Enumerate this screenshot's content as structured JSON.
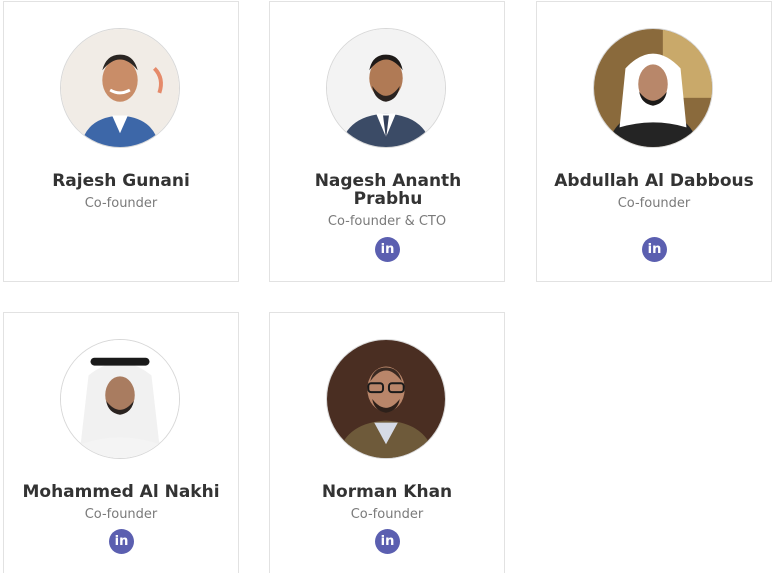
{
  "team": [
    {
      "name": "Rajesh Gunani",
      "role": "Co-founder",
      "has_linkedin": false,
      "photo_icon": "person-photo"
    },
    {
      "name": "Nagesh Ananth Prabhu",
      "role": "Co-founder & CTO",
      "has_linkedin": true,
      "photo_icon": "person-photo"
    },
    {
      "name": "Abdullah Al Dabbous",
      "role": "Co-founder",
      "has_linkedin": true,
      "photo_icon": "person-photo"
    },
    {
      "name": "Mohammed Al Nakhi",
      "role": "Co-founder",
      "has_linkedin": true,
      "photo_icon": "person-photo"
    },
    {
      "name": "Norman Khan",
      "role": "Co-founder",
      "has_linkedin": true,
      "photo_icon": "person-photo"
    }
  ],
  "linkedin": {
    "label": "in",
    "color": "#5b5fb0",
    "icon": "linkedin-icon"
  }
}
